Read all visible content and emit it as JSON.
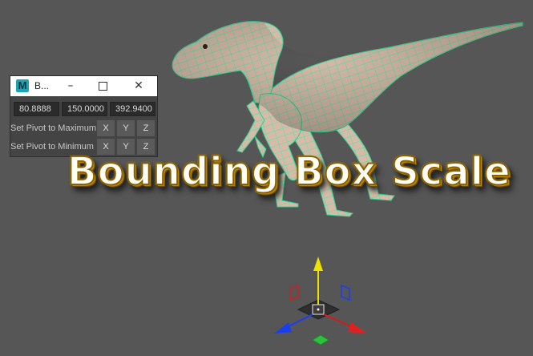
{
  "window": {
    "title": "B...",
    "icon_letter": "M",
    "minimize_glyph": "–",
    "close_glyph": "✕"
  },
  "fields": [
    "80.8888",
    "150.0000",
    "392.9400"
  ],
  "rows": [
    {
      "label": "Set Pivot to Maximum",
      "buttons": [
        "X",
        "Y",
        "Z"
      ]
    },
    {
      "label": "Set Pivot to Minimum",
      "buttons": [
        "X",
        "Y",
        "Z"
      ]
    }
  ],
  "overlay": {
    "title": "Bounding Box Scale"
  },
  "colors": {
    "viewport_bg": "#565656",
    "wireframe": "#3ff0a8",
    "mesh_skin": "#d4b8a5",
    "overlay_outline": "#c99200",
    "axis_x": "#e02020",
    "axis_y": "#f0e000",
    "axis_z": "#1a3ff0"
  }
}
